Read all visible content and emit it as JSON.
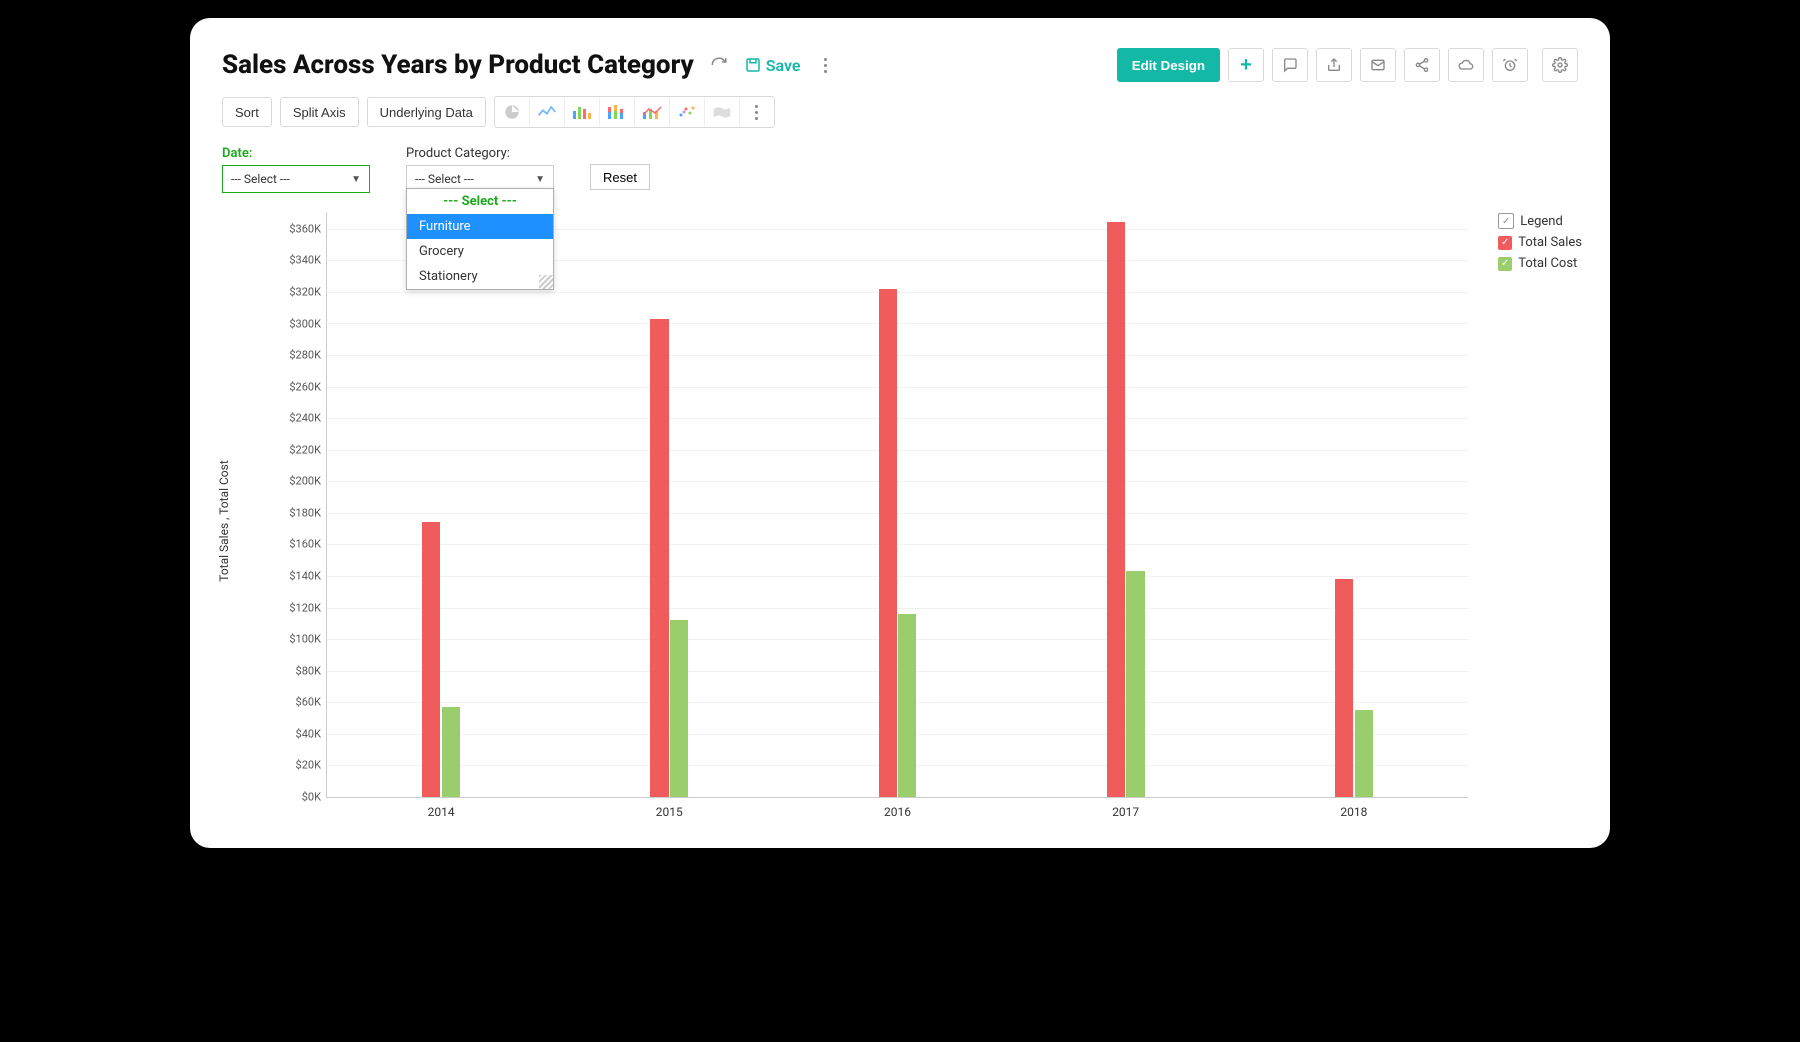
{
  "header": {
    "title": "Sales Across Years by Product Category",
    "save_label": "Save",
    "edit_design": "Edit Design"
  },
  "toolbar": {
    "sort": "Sort",
    "split_axis": "Split Axis",
    "underlying_data": "Underlying Data"
  },
  "filters": {
    "date_label": "Date:",
    "date_placeholder": "--- Select ---",
    "category_label": "Product Category:",
    "category_placeholder": "--- Select ---",
    "reset": "Reset",
    "dropdown": {
      "select": "--- Select ---",
      "opt1": "Furniture",
      "opt2": "Grocery",
      "opt3": "Stationery"
    }
  },
  "legend": {
    "title": "Legend",
    "s1": "Total Sales",
    "s2": "Total Cost"
  },
  "axis": {
    "ylabel": "Total Sales , Total Cost"
  },
  "colors": {
    "sales": "#F05C5C",
    "cost": "#9ACD6B",
    "accent": "#14B8A6"
  },
  "chart_data": {
    "type": "bar",
    "title": "Sales Across Years by Product Category",
    "xlabel": "",
    "ylabel": "Total Sales , Total Cost",
    "ylim": [
      0,
      370000
    ],
    "ytick_step": 20000,
    "categories": [
      "2014",
      "2015",
      "2016",
      "2017",
      "2018"
    ],
    "series": [
      {
        "name": "Total Sales",
        "color": "#F05C5C",
        "values": [
          174000,
          303000,
          322000,
          364000,
          138000
        ]
      },
      {
        "name": "Total Cost",
        "color": "#9ACD6B",
        "values": [
          57000,
          112000,
          116000,
          143000,
          55000
        ]
      }
    ]
  }
}
